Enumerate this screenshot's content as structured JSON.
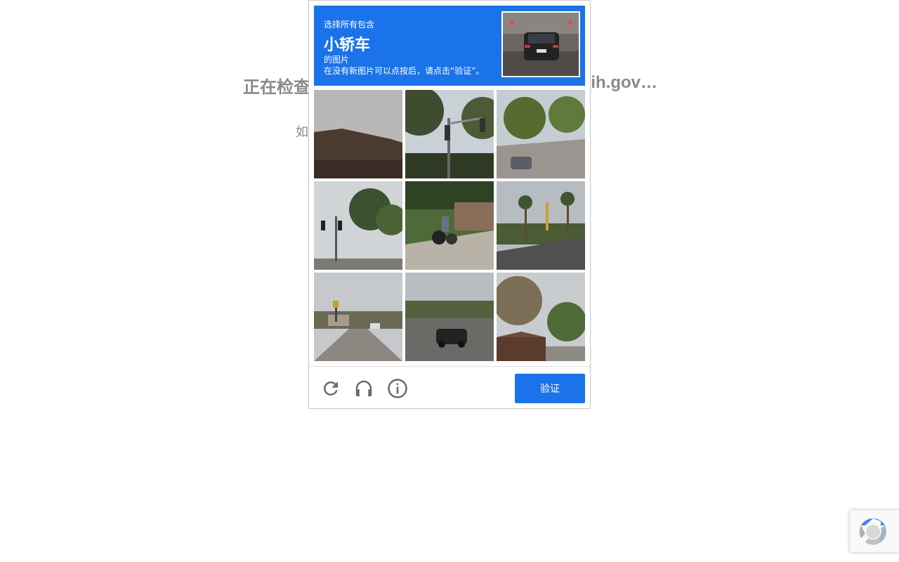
{
  "background": {
    "heading_left": "正在检查",
    "heading_right": "ih.gov…",
    "sub_left": "如",
    "sub_right": "。"
  },
  "challenge": {
    "instruction_line1": "选择所有包含",
    "target_object": "小轿车",
    "instruction_line3": "的图片",
    "instruction_line4": "在没有新图片可以点按后，请点击“验证”。",
    "accent_color": "#1a73e8",
    "tiles": [
      {
        "index": 1,
        "content": "building-roof"
      },
      {
        "index": 2,
        "content": "traffic-light-trees"
      },
      {
        "index": 3,
        "content": "street-with-car"
      },
      {
        "index": 4,
        "content": "palm-trees-traffic-lights"
      },
      {
        "index": 5,
        "content": "motorcycle-rider"
      },
      {
        "index": 6,
        "content": "palm-trees-road"
      },
      {
        "index": 7,
        "content": "street-intersection"
      },
      {
        "index": 8,
        "content": "road-with-car"
      },
      {
        "index": 9,
        "content": "trees-house"
      }
    ]
  },
  "footer": {
    "reload_icon": "reload-icon",
    "audio_icon": "headphones-icon",
    "info_icon": "info-icon",
    "verify_label": "验证"
  },
  "badge": {
    "icon": "recaptcha-logo-icon"
  }
}
